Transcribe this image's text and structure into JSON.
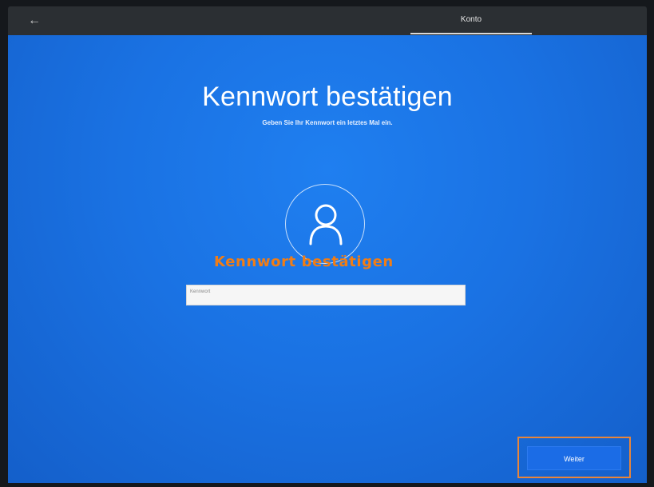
{
  "topbar": {
    "back_label": "←",
    "step_label": "Konto"
  },
  "main": {
    "title": "Kennwort bestätigen",
    "subtitle": "Geben Sie Ihr Kennwort ein letztes Mal ein."
  },
  "password_field": {
    "placeholder": "Kennwort"
  },
  "annotation": {
    "text": "Kennwort bestätigen",
    "color": "#f07d16"
  },
  "footer": {
    "next_label": "Weiter"
  },
  "icons": {
    "back": "back-arrow-icon",
    "avatar": "user-icon"
  },
  "colors": {
    "background_blue": "#1a72e3",
    "highlight": "#e8853a"
  }
}
